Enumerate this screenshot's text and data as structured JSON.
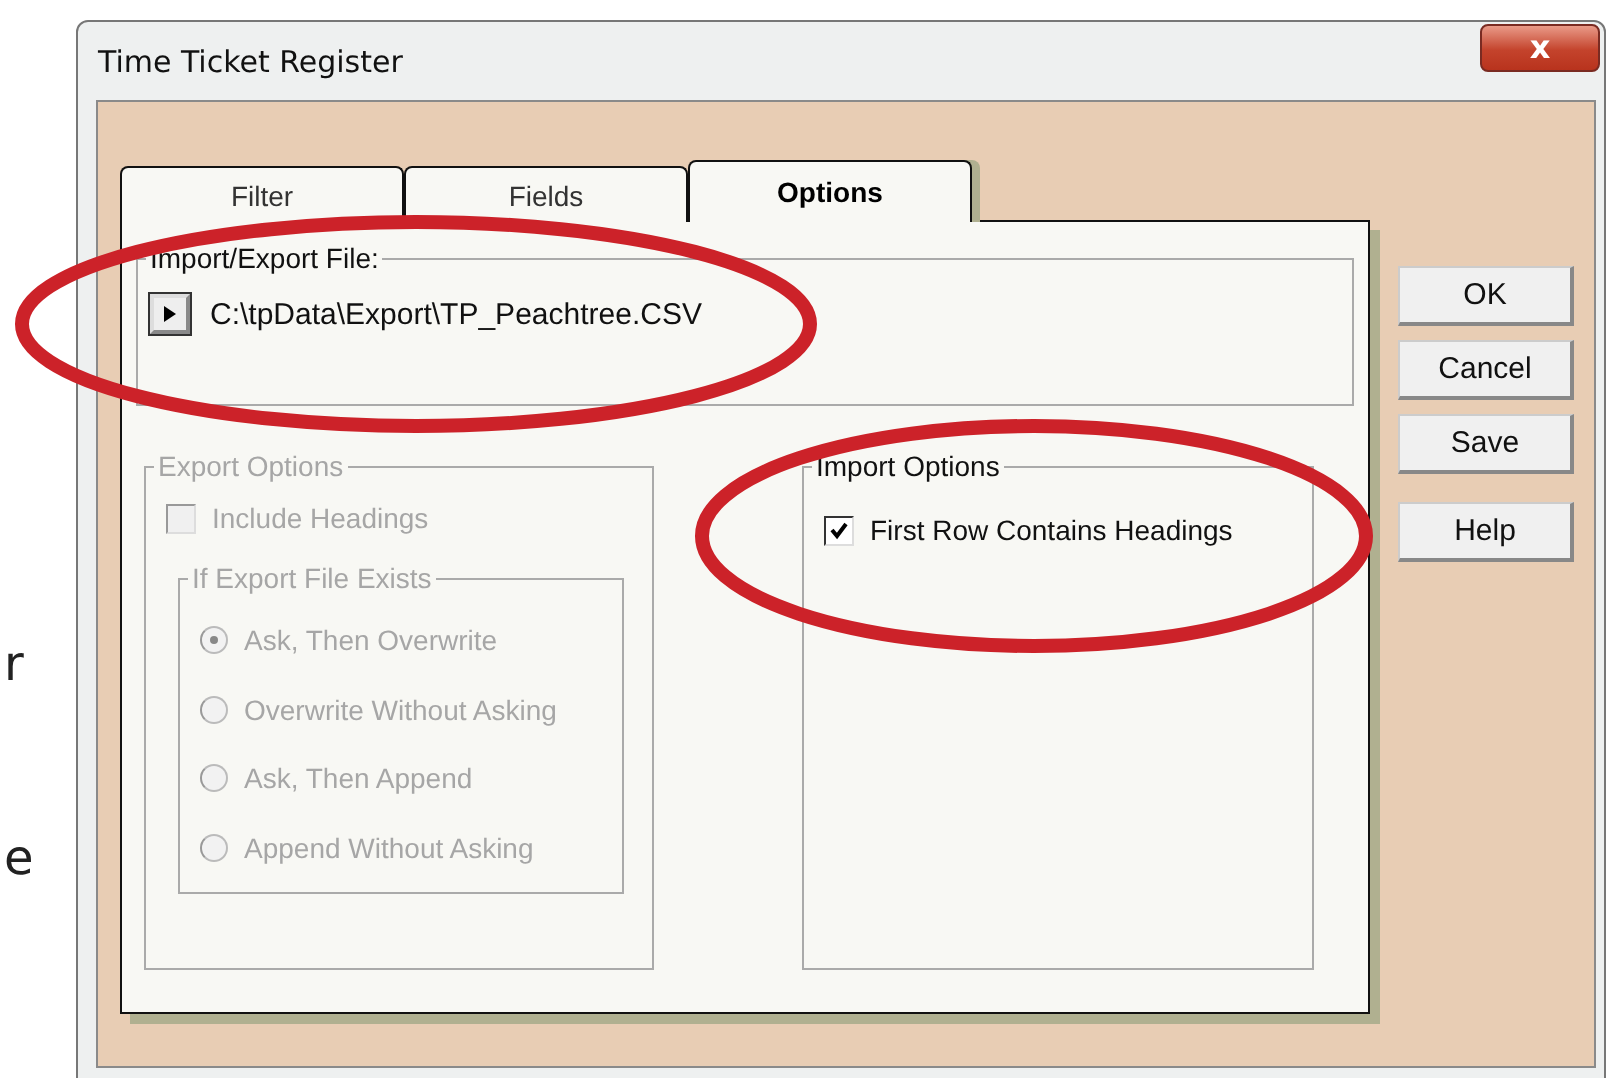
{
  "background_text": [
    "r",
    "e"
  ],
  "window": {
    "title": "Time Ticket Register",
    "close_label": "x"
  },
  "tabs": [
    {
      "label": "Filter",
      "selected": false
    },
    {
      "label": "Fields",
      "selected": false
    },
    {
      "label": "Options",
      "selected": true
    }
  ],
  "file_group": {
    "title": "Import/Export File:",
    "path": "C:\\tpData\\Export\\TP_Peachtree.CSV"
  },
  "export_options": {
    "title": "Export Options",
    "disabled": true,
    "include_headings": {
      "label": "Include Headings",
      "checked": false
    },
    "exists_group": {
      "title": "If Export File Exists",
      "options": [
        {
          "label": "Ask, Then Overwrite",
          "selected": true
        },
        {
          "label": "Overwrite Without Asking",
          "selected": false
        },
        {
          "label": "Ask, Then Append",
          "selected": false
        },
        {
          "label": "Append Without Asking",
          "selected": false
        }
      ]
    }
  },
  "import_options": {
    "title": "Import Options",
    "first_row_headings": {
      "label": "First Row Contains Headings",
      "checked": true
    }
  },
  "buttons": [
    "OK",
    "Cancel",
    "Save",
    "Help"
  ]
}
